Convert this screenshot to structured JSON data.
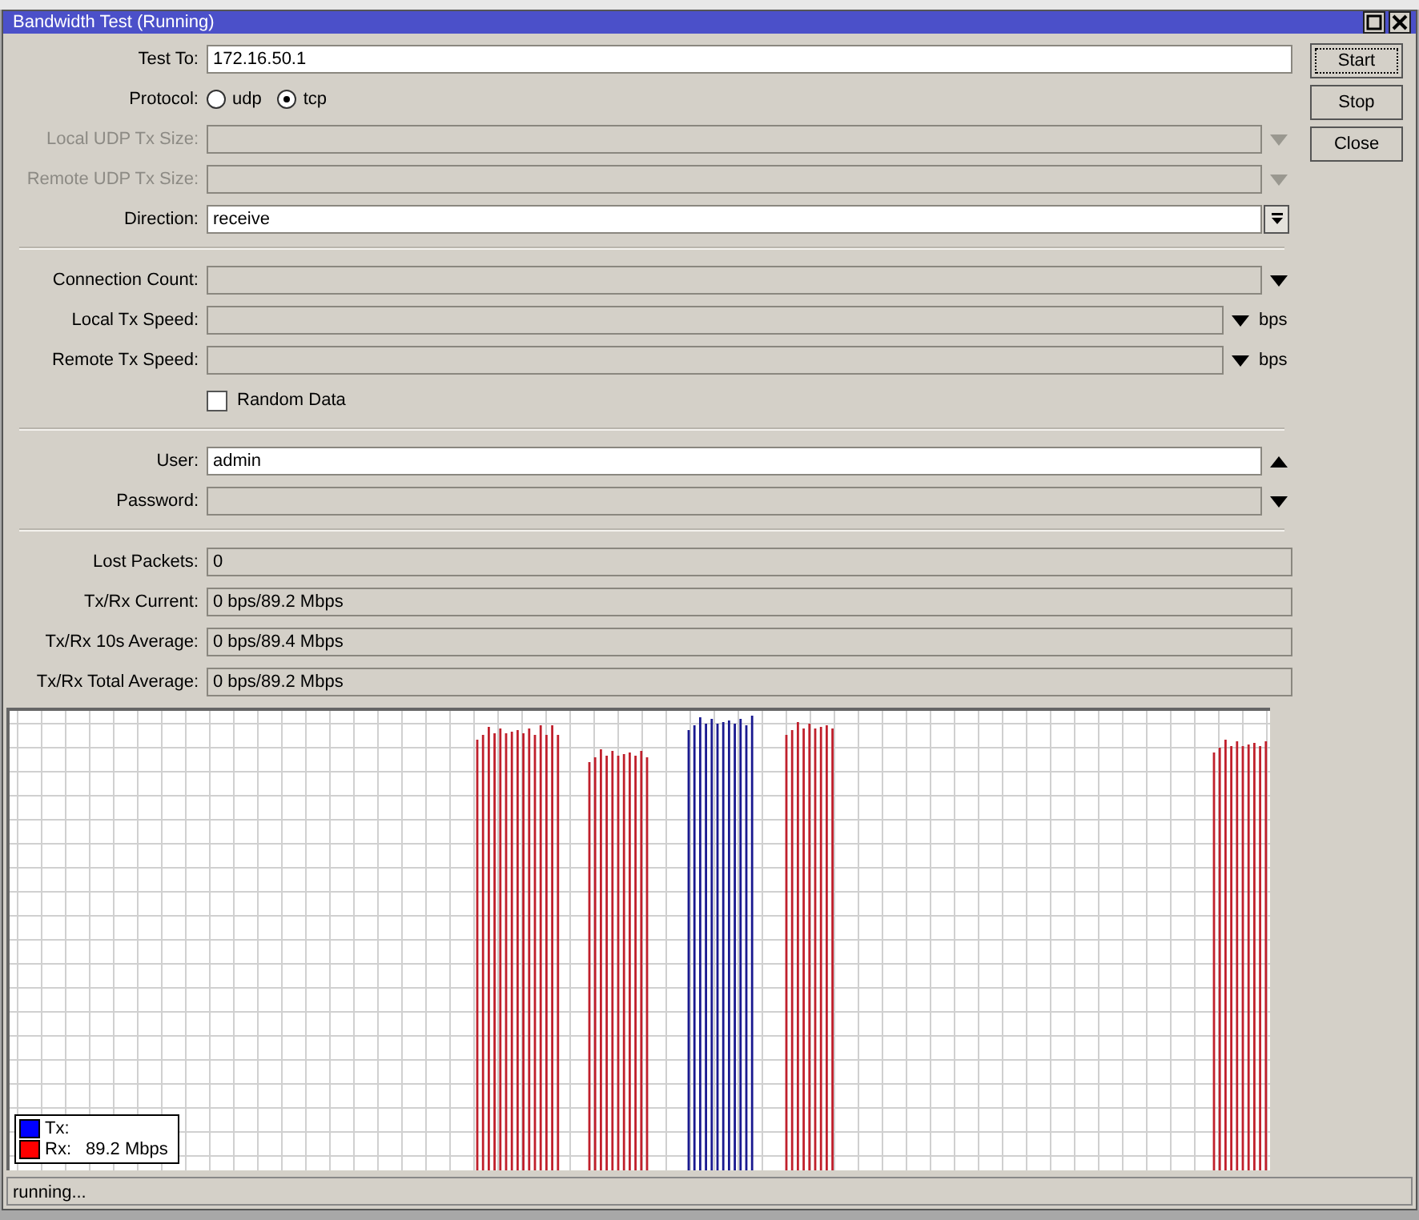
{
  "window": {
    "title": "Bandwidth Test (Running)"
  },
  "sections": [
    [
      {
        "kind": "text",
        "label": "Test To:",
        "value": "172.16.50.1"
      },
      {
        "kind": "radio",
        "label": "Protocol:",
        "options": [
          {
            "label": "udp",
            "selected": false
          },
          {
            "label": "tcp",
            "selected": true
          }
        ]
      },
      {
        "kind": "combo",
        "label": "Local UDP Tx Size:",
        "disabled": true,
        "expanded": false
      },
      {
        "kind": "combo",
        "label": "Remote UDP Tx Size:",
        "disabled": true,
        "expanded": false
      },
      {
        "kind": "select",
        "label": "Direction:",
        "value": "receive",
        "disabled": false
      }
    ],
    [
      {
        "kind": "combo",
        "label": "Connection Count:",
        "disabled": false,
        "expanded": false
      },
      {
        "kind": "speed",
        "label": "Local Tx Speed:",
        "unit": "bps",
        "disabled": false,
        "expanded": false
      },
      {
        "kind": "speed",
        "label": "Remote Tx Speed:",
        "unit": "bps",
        "disabled": false,
        "expanded": false
      },
      {
        "kind": "checkbox",
        "label": "Random Data",
        "checked": false
      }
    ],
    [
      {
        "kind": "combo",
        "label": "User:",
        "value": "admin",
        "disabled": false,
        "expanded": true
      },
      {
        "kind": "combo",
        "label": "Password:",
        "disabled": false,
        "expanded": false
      }
    ],
    [
      {
        "kind": "readout",
        "label": "Lost Packets:",
        "value": "0"
      },
      {
        "kind": "readout",
        "label": "Tx/Rx Current:",
        "value": "0 bps/89.2 Mbps"
      },
      {
        "kind": "readout",
        "label": "Tx/Rx 10s Average:",
        "value": "0 bps/89.4 Mbps"
      },
      {
        "kind": "readout",
        "label": "Tx/Rx Total Average:",
        "value": "0 bps/89.2 Mbps"
      }
    ]
  ],
  "buttons": [
    {
      "label": "Start",
      "focused": true
    },
    {
      "label": "Stop",
      "focused": false
    },
    {
      "label": "Close",
      "focused": false
    }
  ],
  "graph": {
    "legend": [
      {
        "label": "Tx:",
        "color": "#0000ff"
      },
      {
        "label": "Rx:",
        "value": "89.2 Mbps",
        "color": "#ff0000"
      }
    ]
  },
  "status_bar": "running..."
}
